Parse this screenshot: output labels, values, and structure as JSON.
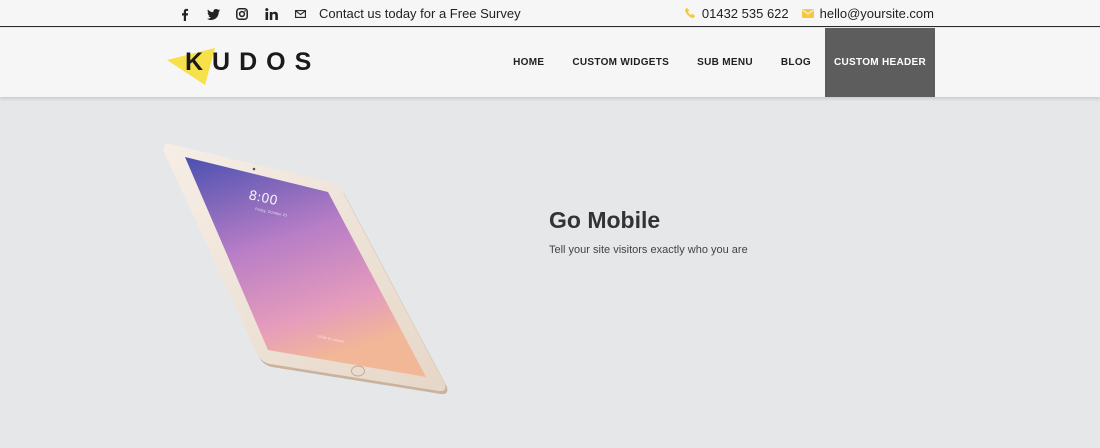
{
  "topbar": {
    "social_icons": [
      "facebook-icon",
      "twitter-icon",
      "instagram-icon",
      "linkedin-icon",
      "mail-icon"
    ],
    "cta_text": "Contact us today for a Free Survey",
    "phone": "01432 535 622",
    "email": "hello@yoursite.com",
    "accent_color": "#f5c842"
  },
  "header": {
    "logo_text": "KUDOS",
    "nav": [
      {
        "label": "HOME"
      },
      {
        "label": "CUSTOM WIDGETS"
      },
      {
        "label": "SUB MENU"
      },
      {
        "label": "BLOG"
      },
      {
        "label": "CUSTOM HEADER",
        "active": true
      }
    ],
    "active_color": "#5d5d5d"
  },
  "hero": {
    "title": "Go Mobile",
    "subtitle": "Tell your site visitors exactly who you are",
    "device_image": "tablet",
    "lockscreen_time": "8:00",
    "lockscreen_date": "Friday, October 23",
    "lockscreen_hint": "› Slide to unlock"
  }
}
